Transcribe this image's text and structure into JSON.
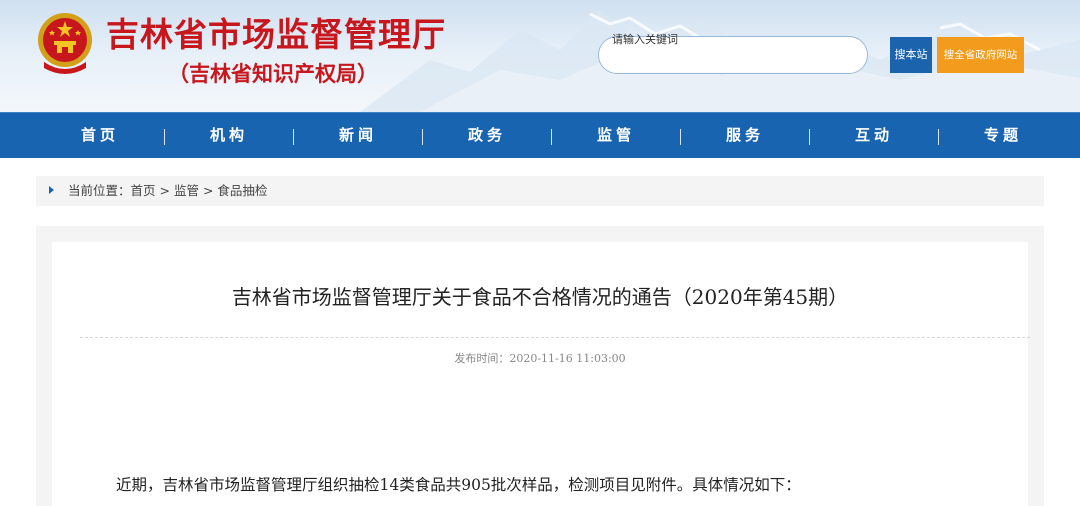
{
  "header": {
    "site_title": "吉林省市场监督管理厅",
    "site_subtitle": "（吉林省知识产权局）",
    "search_placeholder": "请输入关键词",
    "search_site_button": "搜本站",
    "search_province_button": "搜全省政府网站",
    "emblem_icon": "national-emblem-icon"
  },
  "nav": {
    "items": [
      "首页",
      "机构",
      "新闻",
      "政务",
      "监管",
      "服务",
      "互动",
      "专题"
    ]
  },
  "breadcrumb": {
    "prefix": "当前位置：",
    "home": "首页",
    "sep1": " > ",
    "level1": "监管",
    "sep2": " > ",
    "level2": "食品抽检"
  },
  "article": {
    "title": "吉林省市场监督管理厅关于食品不合格情况的通告（2020年第45期）",
    "publish_time": "发布时间：2020-11-16 11:03:00",
    "body_first_line": "近期，吉林省市场监督管理厅组织抽检14类食品共905批次样品，检测项目见附件。具体情况如下："
  },
  "colors": {
    "brand_red": "#c8161d",
    "nav_blue": "#1964b0",
    "search_site_btn": "#1b63ad",
    "search_province_btn": "#f29b1d"
  }
}
